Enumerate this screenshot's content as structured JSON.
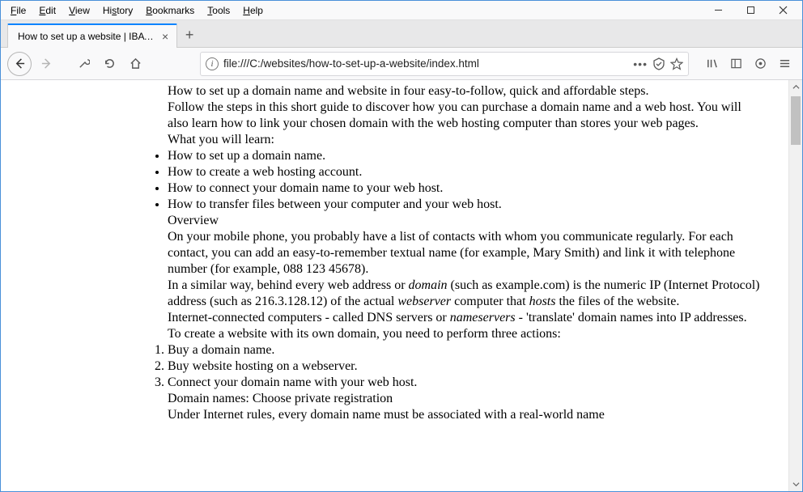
{
  "menubar": {
    "items": [
      "File",
      "Edit",
      "View",
      "History",
      "Bookmarks",
      "Tools",
      "Help"
    ]
  },
  "tab": {
    "title": "How to set up a website | IBAT Port…"
  },
  "url": "file:///C:/websites/how-to-set-up-a-website/index.html",
  "doc": {
    "intro1": "How to set up a domain name and website in four easy-to-follow, quick and affordable steps.",
    "intro2": "Follow the steps in this short guide to discover how you can purchase a domain name and a web host. You will also learn how to link your chosen domain with the web hosting computer than stores your web pages.",
    "learn_h": "What you will learn:",
    "learn": [
      "How to set up a domain name.",
      "How to create a web hosting account.",
      "How to connect your domain name to your web host.",
      "How to transfer files between your computer and your web host."
    ],
    "overview_h": "Overview",
    "ov1a": "On your mobile phone, you probably have a list of contacts with whom you communicate regularly. For each contact, you can add an easy-to-remember textual name (for example, Mary Smith) and link it with telephone number (for example, 088 123 45678).",
    "ov2_pre": "In a similar way, behind every web address or ",
    "ov2_i1": "domain",
    "ov2_mid": " (such as example.com) is the numeric IP (Internet Protocol) address (such as 216.3.128.12) of the actual ",
    "ov2_i2": "webserver",
    "ov2_mid2": " computer that ",
    "ov2_i3": "hosts",
    "ov2_post": " the files of the website.",
    "ov3_pre": "Internet-connected computers - called DNS servers or ",
    "ov3_i": "nameservers",
    "ov3_post": " - 'translate' domain names into IP addresses. To create a website with its own domain, you need to perform three actions:",
    "steps": [
      "Buy a domain name.",
      "Buy website hosting on a webserver.",
      "Connect your domain name with your web host."
    ],
    "priv_h": "Domain names: Choose private registration",
    "priv1": "Under Internet rules, every domain name must be associated with a real-world name"
  }
}
